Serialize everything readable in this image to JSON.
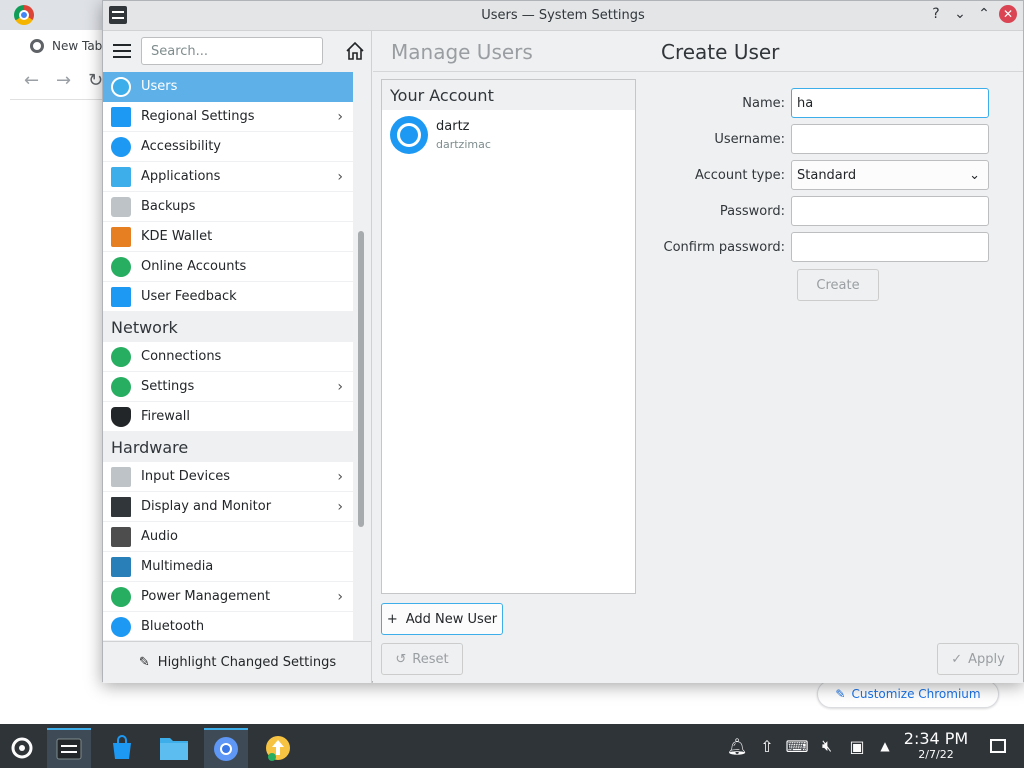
{
  "chromium": {
    "tab_label": "New Tab",
    "customize_label": "Customize Chromium"
  },
  "window": {
    "title": "Users — System Settings"
  },
  "sidebar": {
    "search_placeholder": "Search...",
    "items": [
      {
        "label": "Users",
        "icon": "users-icon",
        "selected": true,
        "chevron": false
      },
      {
        "label": "Regional Settings",
        "icon": "regional-settings-icon",
        "chevron": true
      },
      {
        "label": "Accessibility",
        "icon": "accessibility-icon",
        "chevron": false
      },
      {
        "label": "Applications",
        "icon": "applications-icon",
        "chevron": true
      },
      {
        "label": "Backups",
        "icon": "backups-icon",
        "chevron": false
      },
      {
        "label": "KDE Wallet",
        "icon": "kde-wallet-icon",
        "chevron": false
      },
      {
        "label": "Online Accounts",
        "icon": "online-accounts-icon",
        "chevron": false
      },
      {
        "label": "User Feedback",
        "icon": "user-feedback-icon",
        "chevron": false
      }
    ],
    "network_title": "Network",
    "network_items": [
      {
        "label": "Connections",
        "icon": "connections-icon",
        "chevron": false
      },
      {
        "label": "Settings",
        "icon": "network-settings-icon",
        "chevron": true
      },
      {
        "label": "Firewall",
        "icon": "firewall-icon",
        "chevron": false
      }
    ],
    "hardware_title": "Hardware",
    "hardware_items": [
      {
        "label": "Input Devices",
        "icon": "input-devices-icon",
        "chevron": true
      },
      {
        "label": "Display and Monitor",
        "icon": "display-icon",
        "chevron": true
      },
      {
        "label": "Audio",
        "icon": "audio-icon",
        "chevron": false
      },
      {
        "label": "Multimedia",
        "icon": "multimedia-icon",
        "chevron": false
      },
      {
        "label": "Power Management",
        "icon": "power-icon",
        "chevron": true
      },
      {
        "label": "Bluetooth",
        "icon": "bluetooth-icon",
        "chevron": false
      }
    ],
    "footer_label": "Highlight Changed Settings"
  },
  "main": {
    "breadcrumb": "Manage Users",
    "title": "Create User",
    "account_header": "Your Account",
    "account_name": "dartz",
    "account_username": "dartzimac",
    "add_user_label": "Add New User",
    "form": {
      "name_label": "Name:",
      "name_value": "ha",
      "username_label": "Username:",
      "username_value": "",
      "account_type_label": "Account type:",
      "account_type_value": "Standard",
      "password_label": "Password:",
      "confirm_password_label": "Confirm password:",
      "create_label": "Create"
    },
    "reset_label": "Reset",
    "apply_label": "Apply"
  },
  "taskbar": {
    "time": "2:34 PM",
    "date": "2/7/22"
  },
  "colors": {
    "selection": "#5db0e8",
    "accent": "#3daee9",
    "close": "#da4453",
    "taskbar": "#2f3439"
  }
}
